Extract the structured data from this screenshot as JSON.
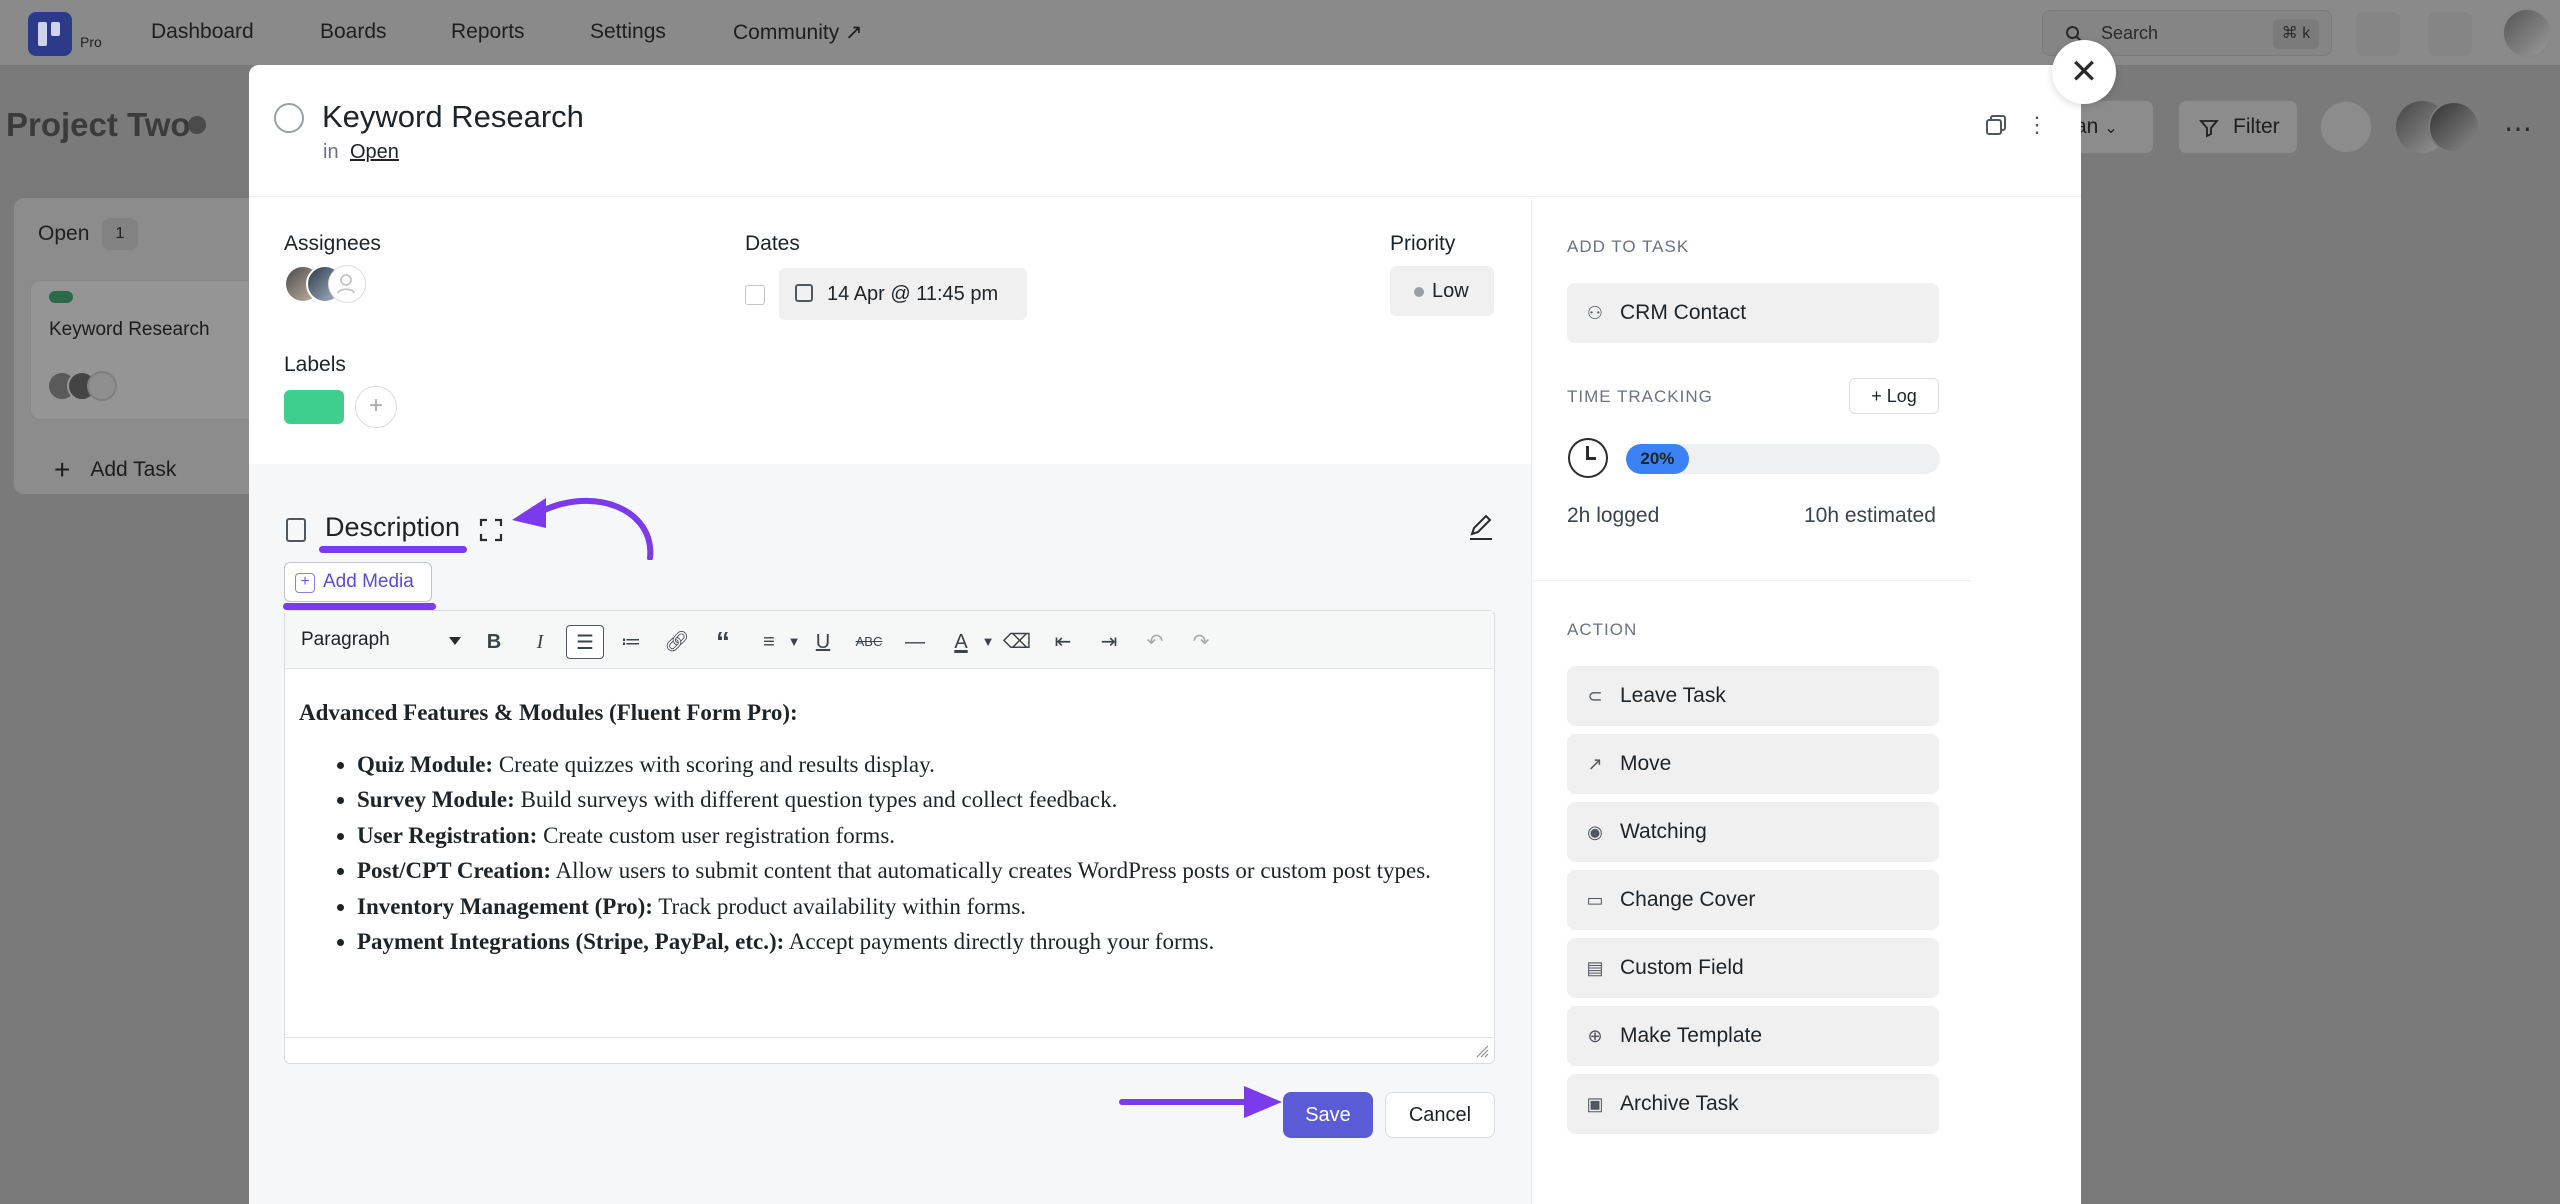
{
  "topbar": {
    "logo_label": "Pro",
    "nav": [
      "Dashboard",
      "Boards",
      "Reports",
      "Settings",
      "Community ↗"
    ],
    "search_placeholder": "Search",
    "search_shortcut": "⌘ k"
  },
  "board": {
    "project_title": "Project Two",
    "view_button": "an",
    "filter_label": "Filter",
    "column": {
      "title": "Open",
      "count": "1"
    },
    "card": {
      "title": "Keyword Research"
    },
    "add_task": "Add Task"
  },
  "task": {
    "title": "Keyword Research",
    "in_label": "in",
    "stage": "Open",
    "assignees_label": "Assignees",
    "dates_label": "Dates",
    "date_value": "14 Apr @ 11:45 pm",
    "priority_label": "Priority",
    "priority_value": "Low",
    "labels_label": "Labels",
    "label_color": "#3ecf8e"
  },
  "description": {
    "title": "Description",
    "add_media": "Add Media",
    "format_select": "Paragraph",
    "heading": "Advanced Features & Modules (Fluent Form Pro):",
    "items": [
      {
        "bold": "Quiz Module:",
        "text": " Create quizzes with scoring and results display."
      },
      {
        "bold": "Survey Module:",
        "text": " Build surveys with different question types and collect feedback."
      },
      {
        "bold": "User Registration:",
        "text": " Create custom user registration forms."
      },
      {
        "bold": "Post/CPT Creation:",
        "text": " Allow users to submit content that automatically creates WordPress posts or custom post types."
      },
      {
        "bold": "Inventory Management (Pro):",
        "text": " Track product availability within forms."
      },
      {
        "bold": "Payment Integrations (Stripe, PayPal, etc.):",
        "text": " Accept payments directly through your forms."
      }
    ],
    "save_label": "Save",
    "cancel_label": "Cancel"
  },
  "sidebar": {
    "add_to_task_heading": "ADD TO TASK",
    "crm_contact": "CRM Contact",
    "time_tracking_heading": "TIME TRACKING",
    "log_label": "Log",
    "progress_percent": 20,
    "progress_text": "20%",
    "logged_text": "2h logged",
    "estimated_text": "10h estimated",
    "action_heading": "ACTION",
    "actions": [
      {
        "label": "Leave Task",
        "icon": "leave-icon"
      },
      {
        "label": "Move",
        "icon": "arrow-up-right-icon"
      },
      {
        "label": "Watching",
        "icon": "eye-icon"
      },
      {
        "label": "Change Cover",
        "icon": "cover-icon"
      },
      {
        "label": "Custom Field",
        "icon": "custom-field-icon"
      },
      {
        "label": "Make Template",
        "icon": "template-icon"
      },
      {
        "label": "Archive Task",
        "icon": "archive-icon"
      }
    ]
  },
  "colors": {
    "accent": "#5b5bd6",
    "annotation": "#7c3aed",
    "progress": "#3b82f6"
  }
}
